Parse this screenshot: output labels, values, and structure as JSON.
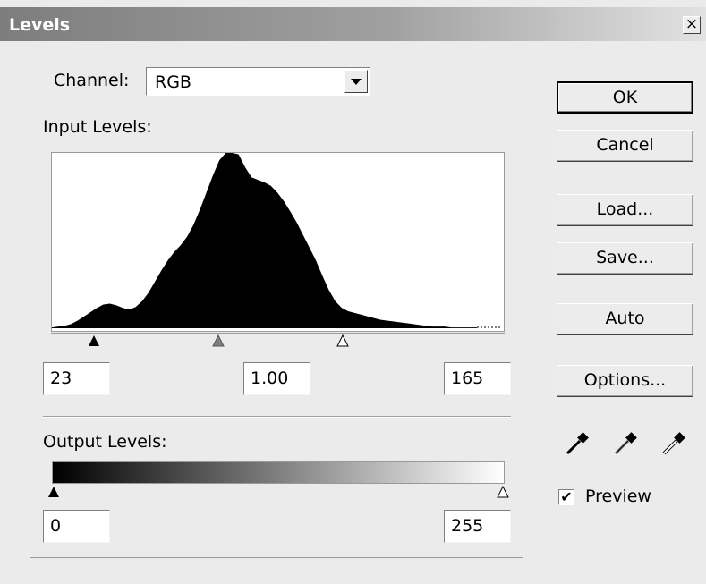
{
  "window": {
    "title": "Levels",
    "close_glyph": "×"
  },
  "channel": {
    "label": "Channel:",
    "value": "RGB"
  },
  "input_levels": {
    "label": "Input Levels:",
    "black": "23",
    "gamma": "1.00",
    "white": "165"
  },
  "output_levels": {
    "label": "Output Levels:",
    "black": "0",
    "white": "255"
  },
  "buttons": {
    "ok": "OK",
    "cancel": "Cancel",
    "load": "Load...",
    "save": "Save...",
    "auto": "Auto",
    "options": "Options..."
  },
  "eyedroppers": [
    "black-eyedropper-icon",
    "gray-eyedropper-icon",
    "white-eyedropper-icon"
  ],
  "preview": {
    "label": "Preview",
    "checked": true,
    "check_glyph": "✔"
  },
  "histogram": {
    "levels": [
      1,
      2,
      3,
      5,
      9,
      14,
      19,
      24,
      28,
      29,
      27,
      24,
      22,
      25,
      32,
      42,
      55,
      68,
      80,
      90,
      98,
      108,
      122,
      140,
      160,
      180,
      198,
      210,
      212,
      205,
      190,
      178,
      175,
      172,
      168,
      160,
      150,
      138,
      125,
      110,
      95,
      80,
      62,
      45,
      32,
      24,
      20,
      18,
      16,
      14,
      12,
      10,
      9,
      8,
      7,
      6,
      5,
      4,
      3,
      2,
      2,
      2,
      1,
      1,
      1,
      1,
      1
    ],
    "max": 212
  },
  "colors": {
    "titlebar_start": "#7d7d7d",
    "titlebar_end": "#e2e2e2",
    "face": "#ebebeb"
  }
}
